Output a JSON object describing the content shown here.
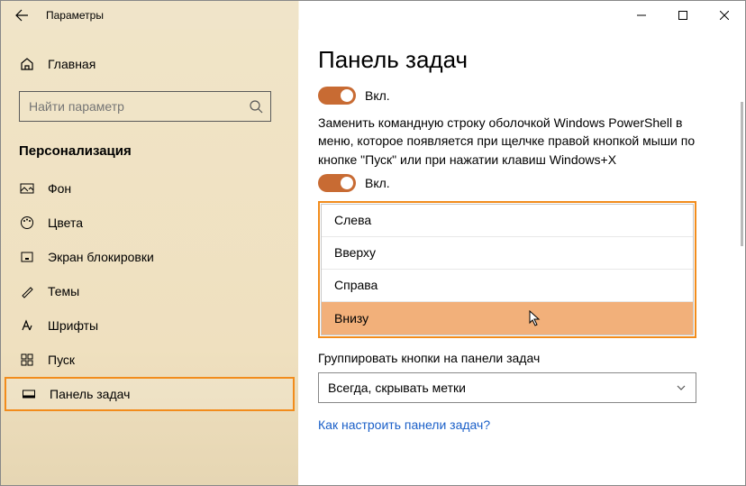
{
  "titlebar": {
    "title": "Параметры"
  },
  "sidebar": {
    "home_label": "Главная",
    "search_placeholder": "Найти параметр",
    "category": "Персонализация",
    "items": [
      {
        "label": "Фон"
      },
      {
        "label": "Цвета"
      },
      {
        "label": "Экран блокировки"
      },
      {
        "label": "Темы"
      },
      {
        "label": "Шрифты"
      },
      {
        "label": "Пуск"
      },
      {
        "label": "Панель задач"
      }
    ]
  },
  "content": {
    "title": "Панель задач",
    "toggle1_label": "Вкл.",
    "desc1": "Заменить командную строку оболочкой Windows PowerShell в меню, которое появляется при щелчке правой кнопкой мыши по кнопке \"Пуск\" или при нажатии клавиш Windows+X",
    "toggle2_label": "Вкл.",
    "position_options": [
      "Слева",
      "Вверху",
      "Справа",
      "Внизу"
    ],
    "group_label": "Группировать кнопки на панели задач",
    "group_value": "Всегда, скрывать метки",
    "help_link": "Как настроить панели задач?"
  }
}
